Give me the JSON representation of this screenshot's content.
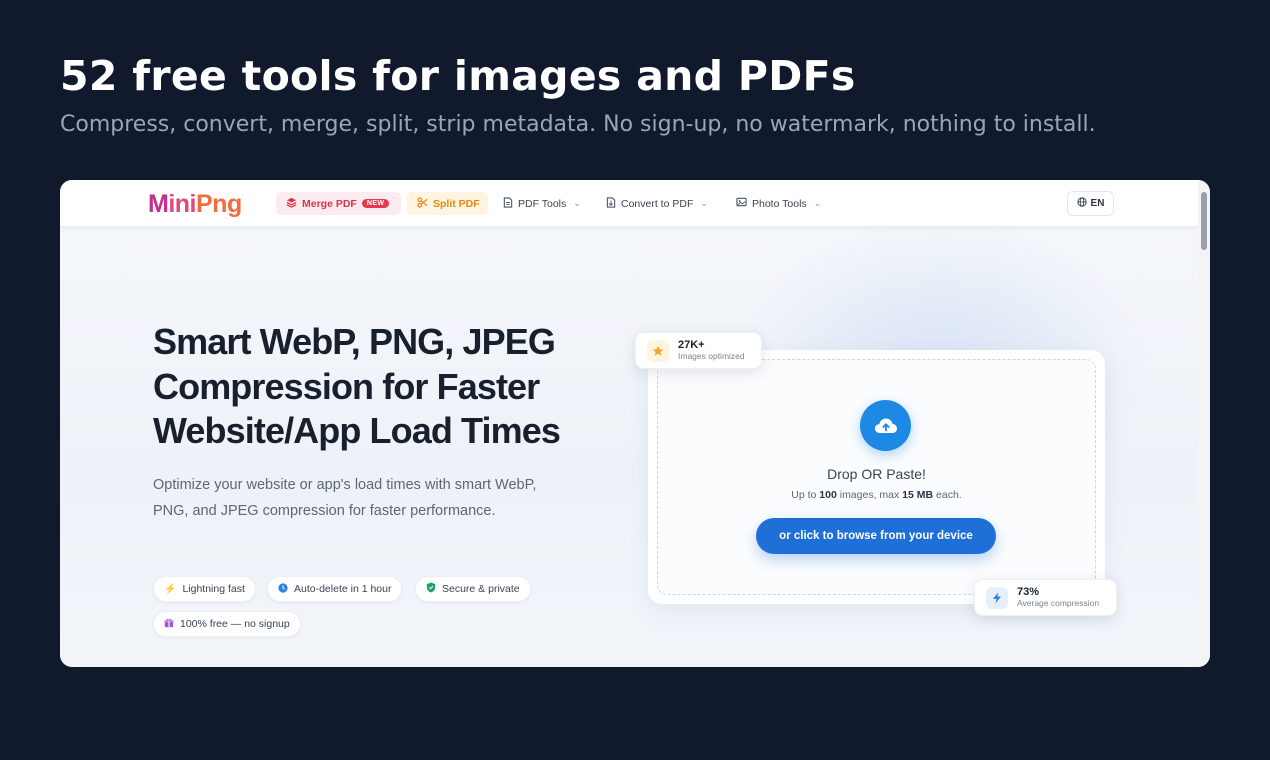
{
  "promo": {
    "title": "52 free tools for images and PDFs",
    "subtitle": "Compress, convert, merge, split, strip metadata. No sign-up, no watermark, nothing to install."
  },
  "nav": {
    "logo": {
      "m": "M",
      "ini": "ini",
      "png": "Png"
    },
    "merge_pdf": "Merge PDF",
    "new_badge": "NEW",
    "split_pdf": "Split PDF",
    "pdf_tools": "PDF Tools",
    "convert_to_pdf": "Convert to PDF",
    "photo_tools": "Photo Tools",
    "language": "EN"
  },
  "hero": {
    "title": "Smart WebP, PNG, JPEG Compression for Faster Website/App Load Times",
    "description": "Optimize your website or app's load times with smart WebP, PNG, and JPEG compression for faster performance.",
    "features": [
      {
        "icon": "lightning-icon",
        "label": "Lightning fast"
      },
      {
        "icon": "clock-icon",
        "label": "Auto-delete in 1 hour"
      },
      {
        "icon": "shield-icon",
        "label": "Secure & private"
      },
      {
        "icon": "gift-icon",
        "label": "100% free — no signup"
      }
    ]
  },
  "dropzone": {
    "title": "Drop OR Paste!",
    "limits_prefix": "Up to ",
    "limits_count": "100",
    "limits_middle": " images, max ",
    "limits_size": "15 MB",
    "limits_suffix": " each.",
    "button": "or click to browse from your device"
  },
  "stats": {
    "optimized_value": "27K+",
    "optimized_label": "Images optimized",
    "compression_value": "73%",
    "compression_label": "Average compression"
  },
  "colors": {
    "page_bg": "#111a2c",
    "primary_blue": "#1e6fd8",
    "merge_red": "#d8334a",
    "split_orange": "#e08a12"
  }
}
